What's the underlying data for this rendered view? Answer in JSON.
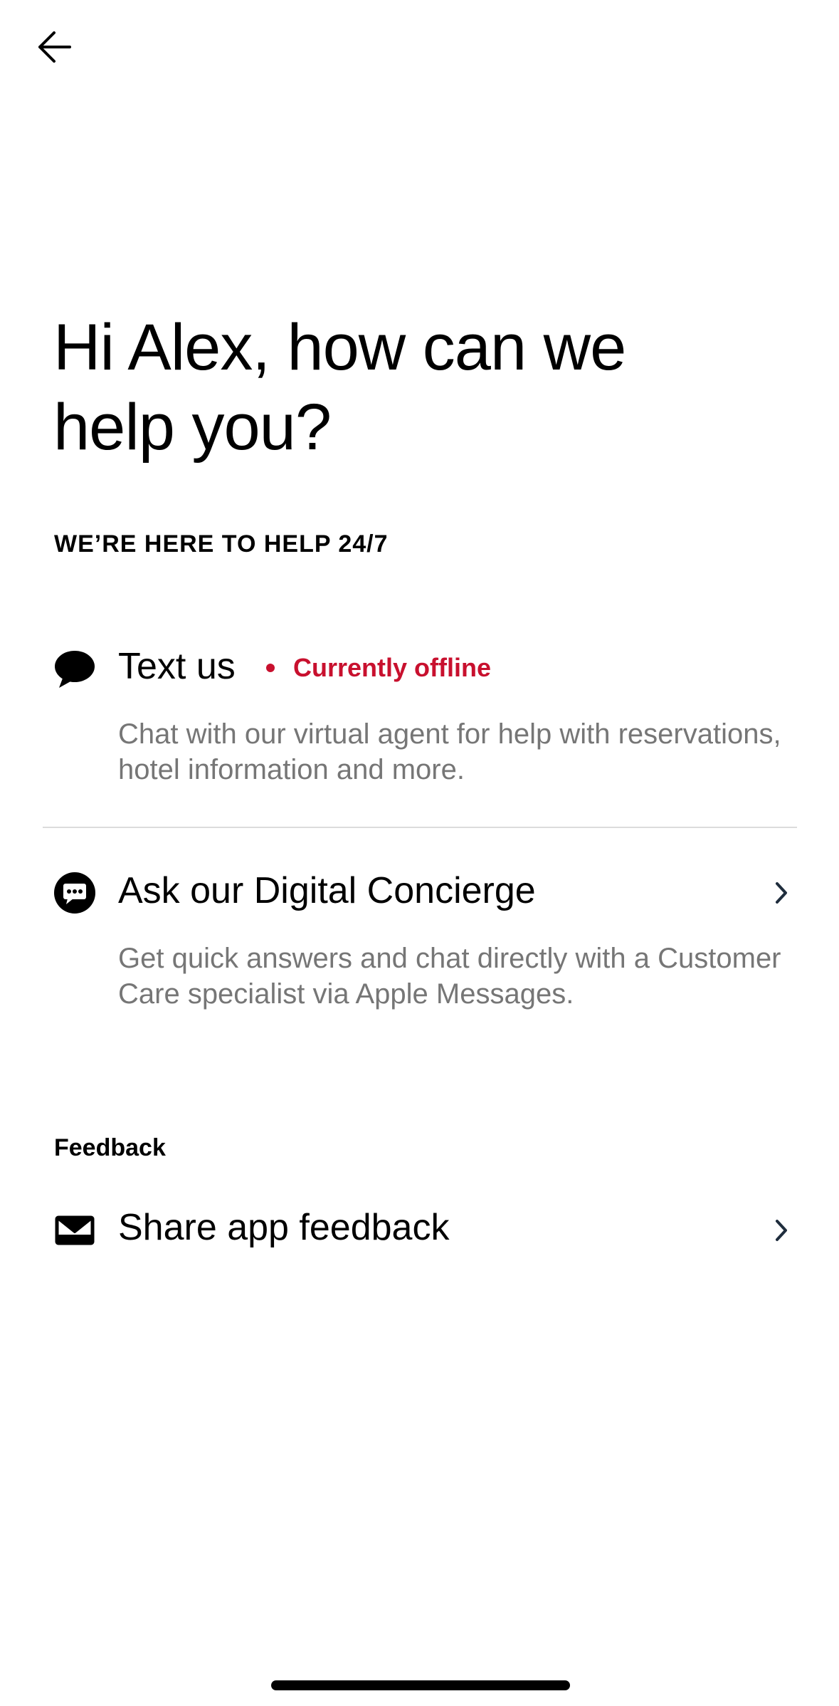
{
  "header": {
    "back_icon": "arrow-left-icon"
  },
  "greeting": "Hi Alex, how can we help you?",
  "help_section": {
    "heading": "WE’RE HERE TO HELP 24/7",
    "text_us": {
      "icon": "speech-bubble-icon",
      "title": "Text us",
      "status": "Currently offline",
      "status_color": "#c8102e",
      "description": "Chat with our virtual agent for help with reservations, hotel information and more."
    },
    "concierge": {
      "icon": "chat-dots-icon",
      "title": "Ask our Digital Concierge",
      "description": "Get quick answers and chat directly with a Customer Care specialist via Apple Messages.",
      "chevron_icon": "chevron-right-icon"
    }
  },
  "feedback_section": {
    "heading": "Feedback",
    "share": {
      "icon": "envelope-icon",
      "title": "Share app feedback",
      "chevron_icon": "chevron-right-icon"
    }
  }
}
